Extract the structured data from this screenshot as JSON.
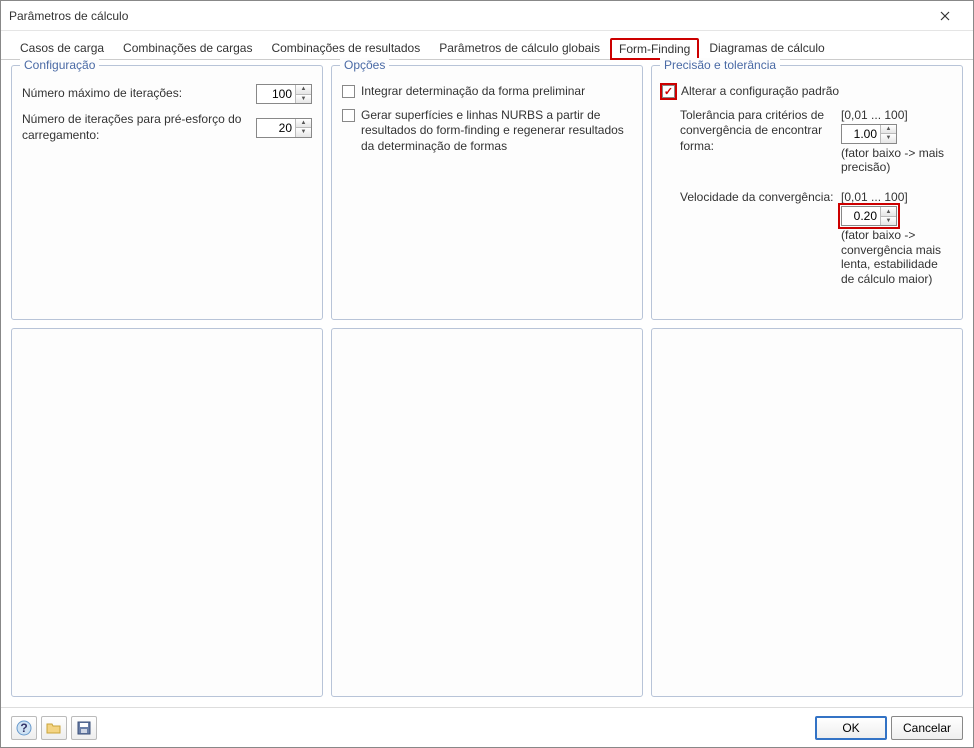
{
  "title": "Parâmetros de cálculo",
  "tabs": {
    "t0": "Casos de carga",
    "t1": "Combinações de cargas",
    "t2": "Combinações de resultados",
    "t3": "Parâmetros de cálculo globais",
    "t4": "Form-Finding",
    "t5": "Diagramas de cálculo"
  },
  "config": {
    "title": "Configuração",
    "max_iter_label": "Número máximo de iterações:",
    "max_iter_value": "100",
    "preload_iter_label": "Número de iterações para pré-esforço do carregamento:",
    "preload_iter_value": "20"
  },
  "options": {
    "title": "Opções",
    "opt1": "Integrar determinação da forma preliminar",
    "opt2": "Gerar superfícies e linhas NURBS a partir de resultados do form-finding e regenerar resultados da determinação de formas"
  },
  "precision": {
    "title": "Precisão e tolerância",
    "alter_label": "Alterar a configuração padrão",
    "tol_label": "Tolerância para critérios de convergência de encontrar forma:",
    "tol_range": "[0,01 ... 100]",
    "tol_value": "1.00",
    "tol_hint": "(fator baixo -> mais precisão)",
    "vel_label": "Velocidade da convergência:",
    "vel_range": "[0,01 ... 100]",
    "vel_value": "0.20",
    "vel_hint": "(fator baixo -> convergência mais lenta, estabilidade de cálculo maior)"
  },
  "footer": {
    "ok": "OK",
    "cancel": "Cancelar"
  }
}
